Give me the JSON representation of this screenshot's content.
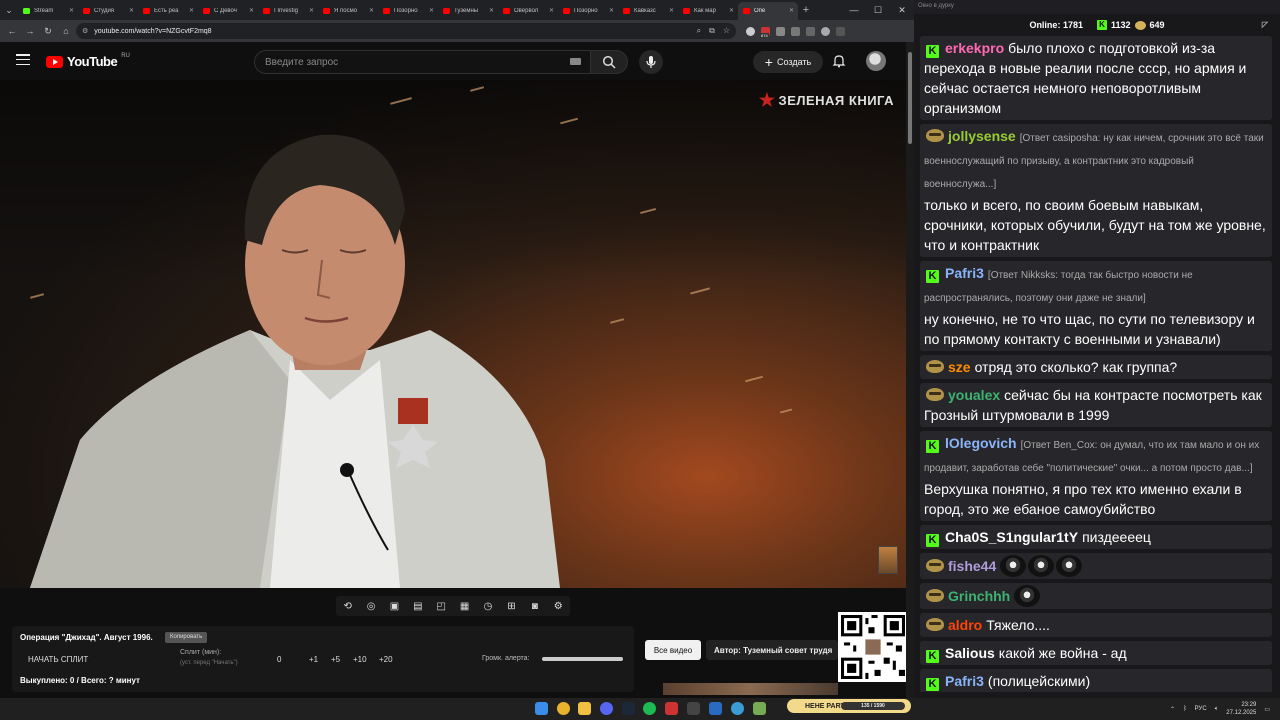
{
  "browser": {
    "tabs": [
      {
        "title": "Stream",
        "color": "#53fc18"
      },
      {
        "title": "Студия",
        "color": "#ff0000"
      },
      {
        "title": "Есть реа",
        "color": "#ff0000"
      },
      {
        "title": "С Девоч",
        "color": "#ff0000"
      },
      {
        "title": "I Investig",
        "color": "#ff0000"
      },
      {
        "title": "Я посмо",
        "color": "#ff0000"
      },
      {
        "title": "Позорно",
        "color": "#ff0000"
      },
      {
        "title": "Туземны",
        "color": "#ff0000"
      },
      {
        "title": "Овервол",
        "color": "#ff0000"
      },
      {
        "title": "Позорно",
        "color": "#ff0000"
      },
      {
        "title": "Кавказс",
        "color": "#ff0000"
      },
      {
        "title": "Как мар",
        "color": "#ff0000"
      },
      {
        "title": "Опе",
        "color": "#ff0000",
        "active": true
      }
    ],
    "url": "youtube.com/watch?v=NZGcvtF2mq8",
    "ext_badge": "674"
  },
  "youtube": {
    "logo_text": "YouTube",
    "region": "RU",
    "search_placeholder": "Введите запрос",
    "create_label": "Создать"
  },
  "video": {
    "watermark": "ЗЕЛЕНАЯ КНИГА"
  },
  "alert_panel": {
    "title": "Операция \"Джихад\". Август 1996.",
    "copy_label": "Копировать",
    "start_split": "НАЧАТЬ СПЛИТ",
    "split_label": "Сплит (мин):",
    "split_hint": "(уст. перед \"Начать\")",
    "split_value": "0",
    "increments": [
      "+1",
      "+5",
      "+10",
      "+20"
    ],
    "volume_label": "Громк. алерта:",
    "bought": "Выкуплено: 0 / Всего: ? минут",
    "all_videos": "Все видео",
    "author": "Автор: Туземный совет трудя"
  },
  "chat": {
    "window_title": "Окно в дурку",
    "online_label": "Online:",
    "online_count": "1781",
    "kick_count": "1132",
    "other_count": "649",
    "messages": [
      {
        "badge": "k",
        "user": "erkekpro",
        "color": "#ff69b4",
        "reply": "",
        "text": "было плохо с подготовкой из-за перехода в новые реалии после ссср, но армия и сейчас остается немного неповоротливым организмом",
        "emotes": 0
      },
      {
        "badge": "face",
        "user": "jollysense",
        "color": "#9acd32",
        "reply": "[Ответ casiposha: ну как ничем, срочник это всё таки военнослужащий по призыву, а контрактник это кадровый военнослужа...]",
        "text": "только и всего, по своим боевым навыкам, срочники, которых обучили, будут на том же уровне, что и контрактник",
        "emotes": 0
      },
      {
        "badge": "k",
        "user": "Pafri3",
        "color": "#8ab4f8",
        "reply": "[Ответ Nikksks: тогда так быстро новости не распространялись, поэтому они даже не знали]",
        "text": "ну конечно, не то что щас, по сути по телевизору и по прямому контакту с военными и узнавали)",
        "emotes": 0
      },
      {
        "badge": "face",
        "user": "sze",
        "color": "#ff8c00",
        "reply": "",
        "text": "отряд это сколько? как группа?",
        "emotes": 0
      },
      {
        "badge": "face",
        "user": "youalex",
        "color": "#3cb371",
        "reply": "",
        "text": "сейчас бы на контрасте посмотреть как Грозный  штурмовали в 1999",
        "emotes": 0
      },
      {
        "badge": "k",
        "user": "lOlegovich",
        "color": "#8ab4f8",
        "reply": "[Ответ Ben_Cox: он думал, что их там мало и он их продавит, заработав себе \"политические\" очки... а потом просто дав...]",
        "text": "Верхушка понятно, я про тех кто именно ехали в город, это же ебаное самоубийство",
        "emotes": 0
      },
      {
        "badge": "k",
        "user": "Cha0S_S1ngular1tY",
        "color": "#ffffff",
        "reply": "",
        "text": "пиздеееец",
        "emotes": 0
      },
      {
        "badge": "face",
        "user": "fishe44",
        "color": "#b19cd9",
        "reply": "",
        "text": "",
        "emotes": 3
      },
      {
        "badge": "face",
        "user": "Grinchhh",
        "color": "#3cb371",
        "reply": "",
        "text": "",
        "emotes": 1
      },
      {
        "badge": "face",
        "user": "aldro",
        "color": "#ff4500",
        "reply": "",
        "text": "Тяжело....",
        "emotes": 0
      },
      {
        "badge": "k",
        "user": "Salious",
        "color": "#ffffff",
        "reply": "",
        "text": "какой же война - ад",
        "emotes": 0
      },
      {
        "badge": "k",
        "user": "Pafri3",
        "color": "#8ab4f8",
        "reply": "",
        "text": "(полицейскими)",
        "emotes": 0
      }
    ]
  },
  "taskbar": {
    "party_label": "HEHE PARTY",
    "party_progress": "135 / 1590",
    "lang": "РУС",
    "time": "23:29",
    "date": "27.12.2025"
  }
}
